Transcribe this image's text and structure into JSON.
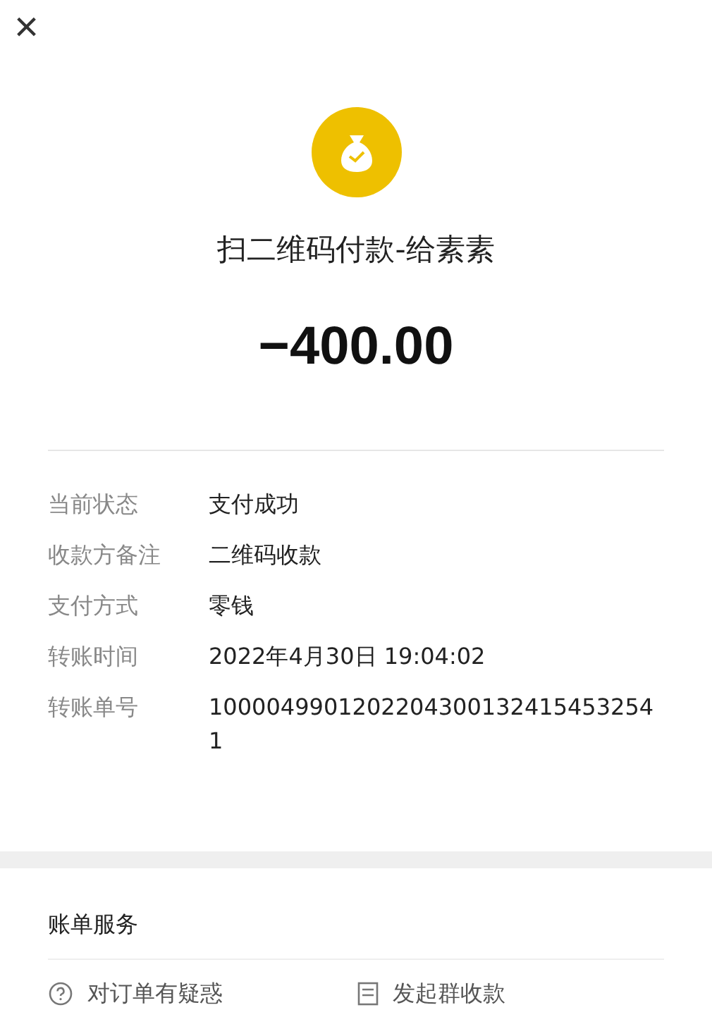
{
  "header": {
    "close": "×"
  },
  "payment": {
    "title": "扫二维码付款-给素素",
    "amount": "−400.00"
  },
  "details": [
    {
      "label": "当前状态",
      "value": "支付成功"
    },
    {
      "label": "收款方备注",
      "value": "二维码收款"
    },
    {
      "label": "支付方式",
      "value": "零钱"
    },
    {
      "label": "转账时间",
      "value": "2022年4月30日 19:04:02"
    },
    {
      "label": "转账单号",
      "value": "10000499012022043001324154532541"
    }
  ],
  "services": {
    "title": "账单服务",
    "actions": [
      {
        "kind": "help",
        "label": "对订单有疑惑"
      },
      {
        "kind": "group",
        "label": "发起群收款"
      }
    ]
  }
}
